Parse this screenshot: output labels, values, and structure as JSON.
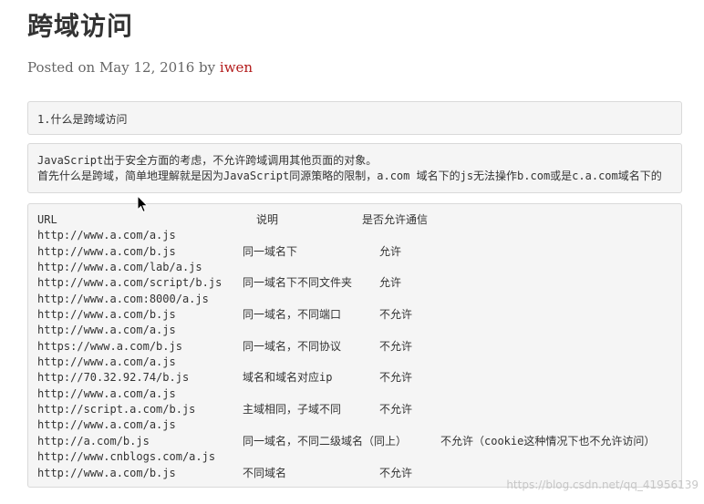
{
  "post": {
    "title": "跨域访问",
    "posted_on": "Posted on May 12, 2016 by ",
    "author": "iwen"
  },
  "boxes": {
    "question": "1.什么是跨域访问",
    "intro_line1": "JavaScript出于安全方面的考虑，不允许跨域调用其他页面的对象。",
    "intro_line2": "首先什么是跨域，简单地理解就是因为JavaScript同源策略的限制，a.com 域名下的js无法操作b.com或是c.a.com域名下的"
  },
  "table": {
    "headers": {
      "url": "URL",
      "desc": "说明",
      "allow": "是否允许通信"
    },
    "rows": [
      {
        "url": "http://www.a.com/a.js",
        "desc": "",
        "allow": ""
      },
      {
        "url": "http://www.a.com/b.js",
        "desc": "同一域名下",
        "allow": "允许"
      },
      {
        "url": "http://www.a.com/lab/a.js",
        "desc": "",
        "allow": ""
      },
      {
        "url": "http://www.a.com/script/b.js",
        "desc": "同一域名下不同文件夹",
        "allow": "允许"
      },
      {
        "url": "http://www.a.com:8000/a.js",
        "desc": "",
        "allow": ""
      },
      {
        "url": "http://www.a.com/b.js",
        "desc": "同一域名，不同端口",
        "allow": "不允许"
      },
      {
        "url": "http://www.a.com/a.js",
        "desc": "",
        "allow": ""
      },
      {
        "url": "https://www.a.com/b.js",
        "desc": "同一域名，不同协议",
        "allow": "不允许"
      },
      {
        "url": "http://www.a.com/a.js",
        "desc": "",
        "allow": ""
      },
      {
        "url": "http://70.32.92.74/b.js",
        "desc": "域名和域名对应ip",
        "allow": "不允许"
      },
      {
        "url": "http://www.a.com/a.js",
        "desc": "",
        "allow": ""
      },
      {
        "url": "http://script.a.com/b.js",
        "desc": "主域相同，子域不同",
        "allow": "不允许"
      },
      {
        "url": "http://www.a.com/a.js",
        "desc": "",
        "allow": ""
      },
      {
        "url": "http://a.com/b.js",
        "desc": "同一域名，不同二级域名（同上）",
        "allow": "不允许（cookie这种情况下也不允许访问）"
      },
      {
        "url": "http://www.cnblogs.com/a.js",
        "desc": "",
        "allow": ""
      },
      {
        "url": "http://www.a.com/b.js",
        "desc": "不同域名",
        "allow": "不允许"
      }
    ]
  },
  "watermark": "https://blog.csdn.net/qq_41956139",
  "colors": {
    "author_link": "#b31b1b",
    "code_background": "#f5f5f5",
    "code_border": "#d9d9d9"
  },
  "icons": {
    "cursor": "mouse-pointer-icon"
  }
}
